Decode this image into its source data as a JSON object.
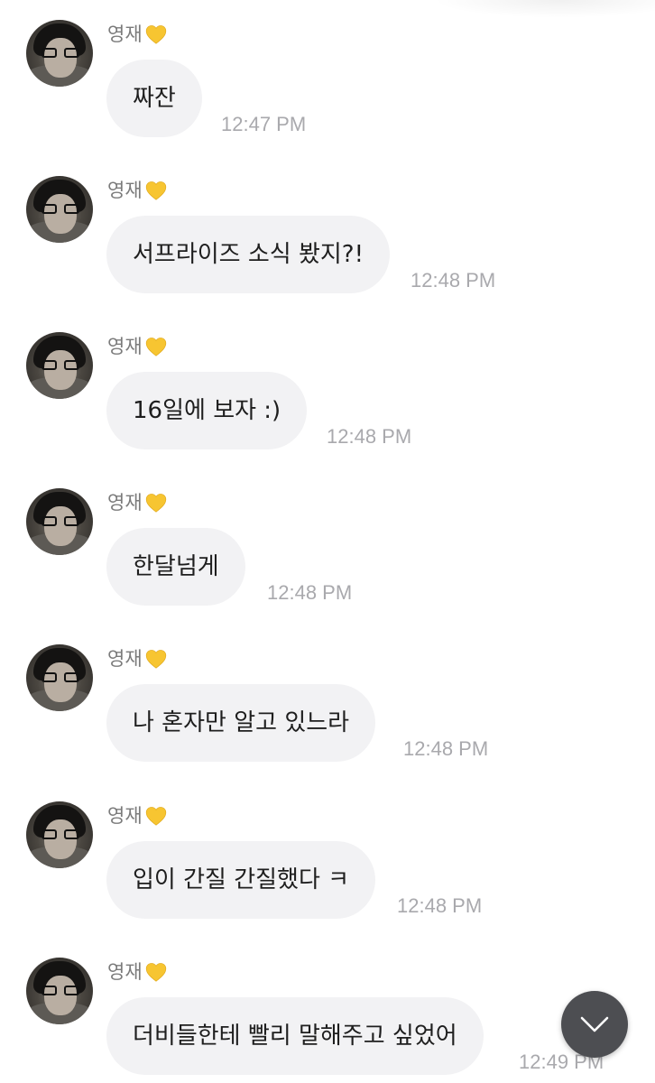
{
  "messages": [
    {
      "sender": "영재",
      "text": "짜잔",
      "time": "12:47 PM"
    },
    {
      "sender": "영재",
      "text": "서프라이즈 소식 봤지?!",
      "time": "12:48 PM"
    },
    {
      "sender": "영재",
      "text": "16일에 보자 :)",
      "time": "12:48 PM"
    },
    {
      "sender": "영재",
      "text": "한달넘게",
      "time": "12:48 PM"
    },
    {
      "sender": "영재",
      "text": "나 혼자만 알고 있느라",
      "time": "12:48 PM"
    },
    {
      "sender": "영재",
      "text": "입이 간질 간질했다 ㅋ",
      "time": "12:48 PM"
    },
    {
      "sender": "영재",
      "text": "더비들한테 빨리 말해주고 싶었어",
      "time": "12:49 PM"
    }
  ],
  "icons": {
    "sender_badge": "yellow-heart-icon",
    "scroll_button": "chevron-down-icon"
  },
  "colors": {
    "bubble": "#f2f2f4",
    "heart": "#f7c531",
    "scroll_button": "#4d4e52"
  }
}
